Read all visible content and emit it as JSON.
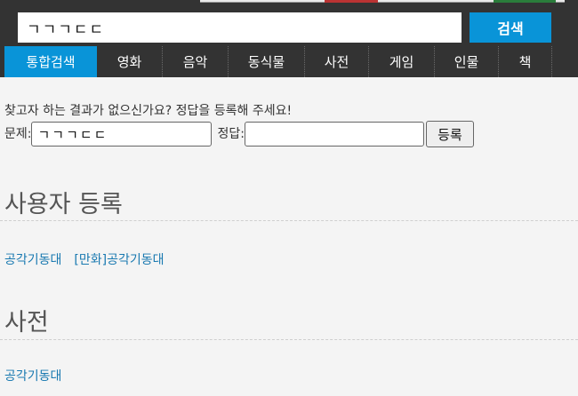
{
  "search": {
    "query": "ㄱㄱㄱㄷㄷ",
    "button_label": "검색"
  },
  "tabs": [
    {
      "label": "통합검색",
      "active": true
    },
    {
      "label": "영화",
      "active": false
    },
    {
      "label": "음악",
      "active": false
    },
    {
      "label": "동식물",
      "active": false
    },
    {
      "label": "사전",
      "active": false
    },
    {
      "label": "게임",
      "active": false
    },
    {
      "label": "인물",
      "active": false
    },
    {
      "label": "책",
      "active": false
    }
  ],
  "register_form": {
    "prompt": "찾고자 하는 결과가 없으신가요? 정답을 등록해 주세요!",
    "question_label": "문제:",
    "question_value": "ㄱㄱㄱㄷㄷ",
    "answer_label": "정답:",
    "answer_value": "",
    "submit_label": "등록"
  },
  "sections": [
    {
      "title": "사용자 등록",
      "links": [
        "공각기동대",
        "[만화]공각기동대"
      ]
    },
    {
      "title": "사전",
      "links": [
        "공각기동대"
      ]
    }
  ],
  "colors": {
    "accent": "#0994d8",
    "header_bg": "#333333",
    "link": "#1778b0"
  }
}
